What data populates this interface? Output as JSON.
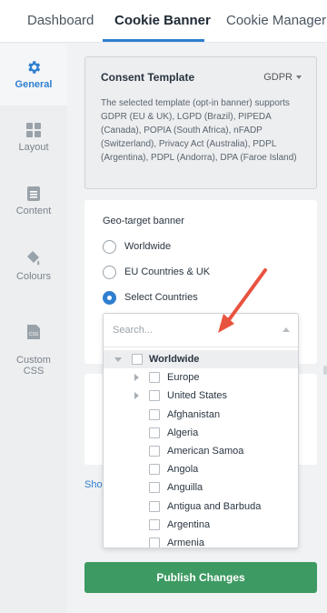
{
  "tabs": [
    {
      "label": "Dashboard"
    },
    {
      "label": "Cookie Banner"
    },
    {
      "label": "Cookie Manager"
    }
  ],
  "sidebar": {
    "items": [
      {
        "label": "General",
        "icon": "gear-icon"
      },
      {
        "label": "Layout",
        "icon": "grid-icon"
      },
      {
        "label": "Content",
        "icon": "document-icon"
      },
      {
        "label": "Colours",
        "icon": "paint-bucket-icon"
      },
      {
        "label": "Custom\nCSS",
        "icon": "css-file-icon"
      }
    ]
  },
  "consent": {
    "title": "Consent Template",
    "selected": "GDPR",
    "description": "The selected template (opt-in banner) supports GDPR (EU & UK), LGPD (Brazil), PIPEDA (Canada), POPIA (South Africa), nFADP (Switzerland), Privacy Act (Australia), PDPL (Argentina), PDPL (Andorra), DPA (Faroe Island)"
  },
  "geo": {
    "title": "Geo-target banner",
    "options": [
      {
        "label": "Worldwide"
      },
      {
        "label": "EU Countries & UK"
      },
      {
        "label": "Select Countries"
      }
    ]
  },
  "dropdown": {
    "placeholder": "Search...",
    "root": "Worldwide",
    "items": [
      "Europe",
      "United States",
      "Afghanistan",
      "Algeria",
      "American Samoa",
      "Angola",
      "Anguilla",
      "Antigua and Barbuda",
      "Argentina",
      "Armenia"
    ]
  },
  "show_link": "Sho",
  "publish_label": "Publish Changes",
  "colors": {
    "accent": "#2f7fd0",
    "publish": "#3d9a62",
    "arrow": "#e8533f"
  }
}
